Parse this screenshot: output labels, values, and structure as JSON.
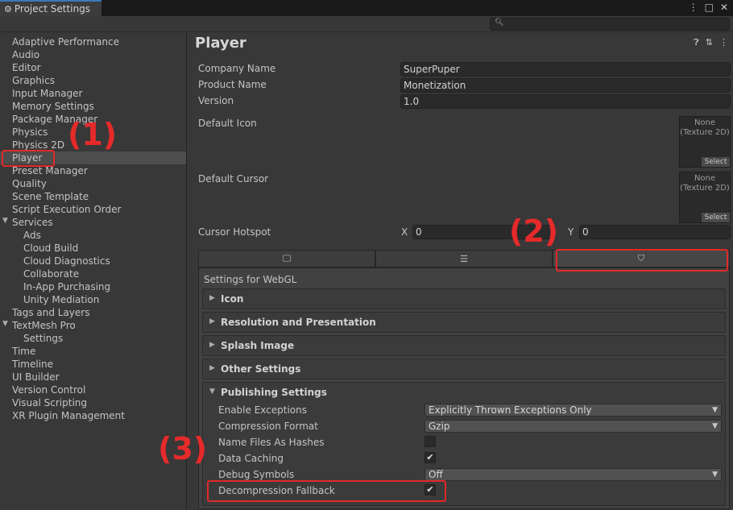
{
  "window": {
    "tab_title": "Project Settings",
    "tab_icon": "gear-icon",
    "menu_icon": "⋮",
    "maximize_icon": "□",
    "close_icon": "✕"
  },
  "search": {
    "placeholder": ""
  },
  "sidebar": {
    "items": [
      {
        "label": "Adaptive Performance"
      },
      {
        "label": "Audio"
      },
      {
        "label": "Editor"
      },
      {
        "label": "Graphics"
      },
      {
        "label": "Input Manager"
      },
      {
        "label": "Memory Settings"
      },
      {
        "label": "Package Manager"
      },
      {
        "label": "Physics"
      },
      {
        "label": "Physics 2D"
      },
      {
        "label": "Player"
      },
      {
        "label": "Preset Manager"
      },
      {
        "label": "Quality"
      },
      {
        "label": "Scene Template"
      },
      {
        "label": "Script Execution Order"
      },
      {
        "label": "Services"
      },
      {
        "label": "Ads"
      },
      {
        "label": "Cloud Build"
      },
      {
        "label": "Cloud Diagnostics"
      },
      {
        "label": "Collaborate"
      },
      {
        "label": "In-App Purchasing"
      },
      {
        "label": "Unity Mediation"
      },
      {
        "label": "Tags and Layers"
      },
      {
        "label": "TextMesh Pro"
      },
      {
        "label": "Settings"
      },
      {
        "label": "Time"
      },
      {
        "label": "Timeline"
      },
      {
        "label": "UI Builder"
      },
      {
        "label": "Version Control"
      },
      {
        "label": "Visual Scripting"
      },
      {
        "label": "XR Plugin Management"
      }
    ],
    "selected": "Player"
  },
  "annotations": {
    "one": "(1)",
    "two": "(2)",
    "three": "(3)"
  },
  "main": {
    "title": "Player",
    "fields": {
      "company_label": "Company Name",
      "company_value": "SuperPuper",
      "product_label": "Product Name",
      "product_value": "Monetization",
      "version_label": "Version",
      "version_value": "1.0",
      "icon_label": "Default Icon",
      "cursor_label": "Default Cursor",
      "hotspot_label": "Cursor Hotspot",
      "x_label": "X",
      "x_value": "0",
      "y_label": "Y",
      "y_value": "0"
    },
    "texture": {
      "line1": "None",
      "line2": "(Texture 2D)",
      "select": "Select"
    },
    "platform_tabs": [
      {
        "icon": "monitor-icon",
        "glyph": "🖵"
      },
      {
        "icon": "server-icon",
        "glyph": "☰"
      },
      {
        "icon": "html5-icon",
        "glyph": "⛉"
      }
    ],
    "settings_for": "Settings for WebGL",
    "foldouts": [
      "Icon",
      "Resolution and Presentation",
      "Splash Image",
      "Other Settings"
    ],
    "publishing": {
      "title": "Publishing Settings",
      "enable_exceptions_label": "Enable Exceptions",
      "enable_exceptions_value": "Explicitly Thrown Exceptions Only",
      "compression_label": "Compression Format",
      "compression_value": "Gzip",
      "name_hashes_label": "Name Files As Hashes",
      "name_hashes_checked": false,
      "data_caching_label": "Data Caching",
      "data_caching_checked": true,
      "debug_symbols_label": "Debug Symbols",
      "debug_symbols_value": "Off",
      "decompression_label": "Decompression Fallback",
      "decompression_checked": true,
      "check_glyph": "✔"
    }
  }
}
